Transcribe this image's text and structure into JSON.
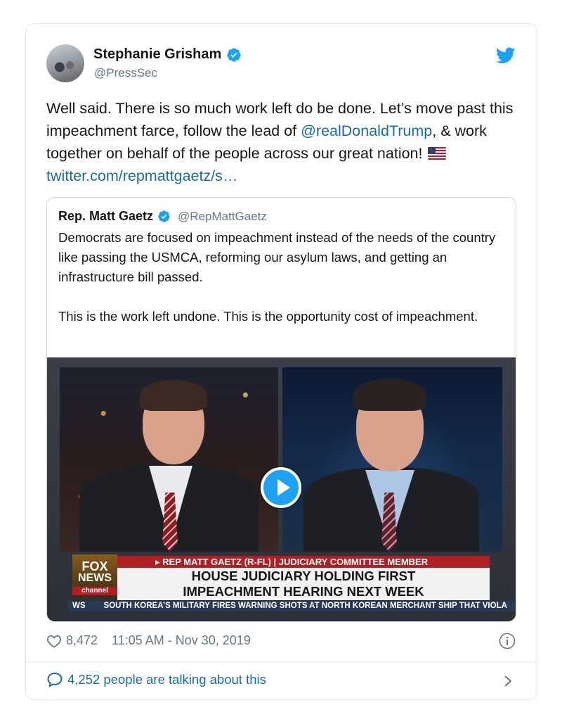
{
  "tweet": {
    "author_name": "Stephanie Grisham",
    "author_handle": "@PressSec",
    "text_part1": "Well said. There is so much work left do be done. Let’s move past this impeachment farce, follow the lead of ",
    "mention": "@realDonaldTrump",
    "text_part2": ", & work together on behalf of the people across our great nation! ",
    "link": "twitter.com/repmattgaetz/s…",
    "likes": "8,472",
    "timestamp": "11:05 AM - Nov 30, 2019",
    "talking": "4,252 people are talking about this"
  },
  "quote": {
    "author_name": "Rep. Matt Gaetz",
    "author_handle": "@RepMattGaetz",
    "paragraph1": "Democrats are focused on impeachment instead of the needs of the country like passing the USMCA, reforming our asylum laws, and getting an infrastructure bill passed.",
    "paragraph2": "This is the work left undone. This is the opportunity cost of impeachment."
  },
  "video": {
    "chyron_top": "▸ REP MATT GAETZ (R-FL) | JUDICIARY COMMITTEE MEMBER",
    "chyron_line1": "HOUSE JUDICIARY HOLDING FIRST",
    "chyron_line2": "IMPEACHMENT HEARING NEXT WEEK",
    "logo_line1": "FOX",
    "logo_line2": "NEWS",
    "logo_line3": "channel",
    "ticker_prefix": "WS",
    "ticker_text": "SOUTH KOREA’S MILITARY FIRES WARNING SHOTS AT NORTH KOREAN MERCHANT SHIP THAT VIOLA"
  },
  "colors": {
    "twitter_blue": "#1da1f2",
    "link_blue": "#1b6aa5",
    "muted_gray": "#657786",
    "fox_red": "#b31e23"
  },
  "icons": [
    "verified-badge-icon",
    "twitter-bird-icon",
    "us-flag-icon",
    "play-icon",
    "heart-icon",
    "info-icon",
    "speech-bubble-icon",
    "chevron-right-icon"
  ]
}
